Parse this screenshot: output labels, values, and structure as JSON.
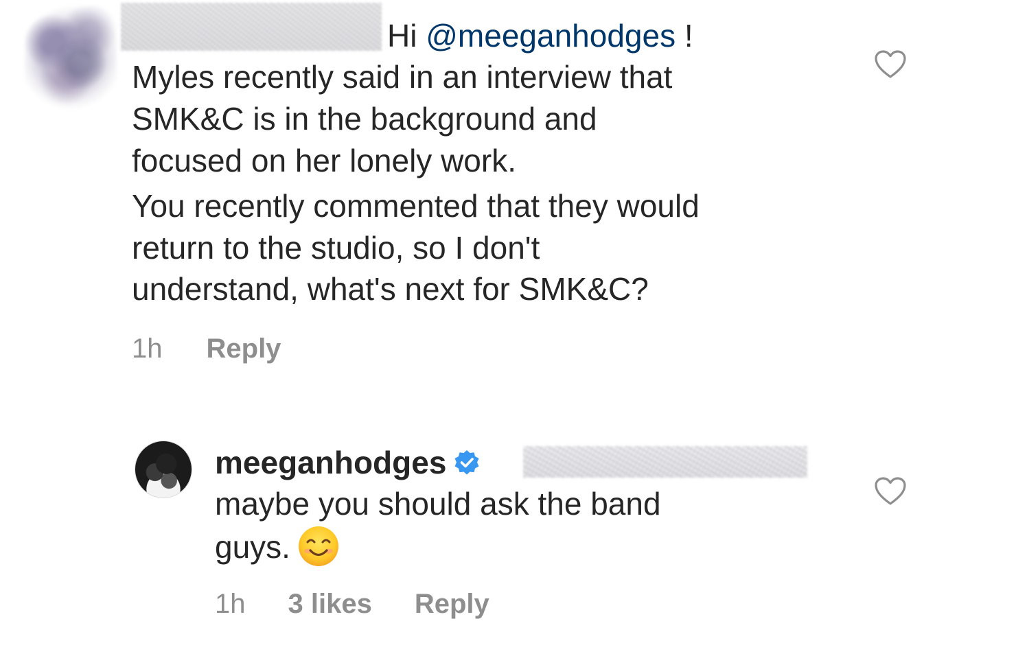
{
  "comment1": {
    "greeting": "Hi ",
    "mention": "@meeganhodges",
    "greeting_end": " !",
    "lines": [
      "Myles recently said in an interview that",
      "SMK&C is in the background and",
      "focused on her lonely work.",
      "You recently commented that they would",
      "return to the studio, so I don't",
      "understand, what's next for SMK&C?"
    ],
    "time": "1h",
    "reply_label": "Reply"
  },
  "comment2": {
    "username": "meeganhodges",
    "lines": [
      "maybe you should ask the band",
      "guys."
    ],
    "time": "1h",
    "likes": "3 likes",
    "reply_label": "Reply"
  },
  "icons": {
    "heart": "heart-outline-icon",
    "verified": "verified-badge-icon",
    "emoji": "smiling-face-emoji"
  },
  "colors": {
    "mention": "#00376b",
    "verified": "#3897f0",
    "meta_gray": "#8e8e8e",
    "text": "#262626"
  }
}
